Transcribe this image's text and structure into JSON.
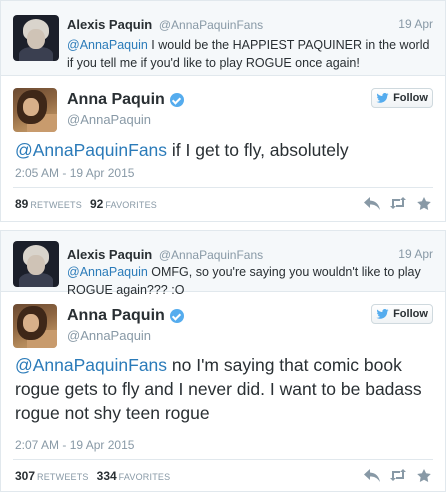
{
  "threads": [
    {
      "reply": {
        "name": "Alexis Paquin",
        "handle": "@AnnaPaquinFans",
        "time": "19 Apr",
        "mention": "@AnnaPaquin",
        "text": " I would be the HAPPIEST PAQUINER in the world if you tell me if you'd like to play ROGUE once again!"
      },
      "tweet": {
        "name": "Anna Paquin",
        "handle": "@AnnaPaquin",
        "follow_label": "Follow",
        "mention": "@AnnaPaquinFans",
        "text": " if I get to fly, absolutely",
        "date": "2:05 AM - 19 Apr 2015",
        "retweets": "89",
        "retweets_label": "RETWEETS",
        "favorites": "92",
        "favorites_label": "FAVORITES"
      }
    },
    {
      "reply": {
        "name": "Alexis Paquin",
        "handle": "@AnnaPaquinFans",
        "time": "19 Apr",
        "mention": "@AnnaPaquin",
        "text": " OMFG, so you're saying you wouldn't like to play ROGUE again??? :O"
      },
      "tweet": {
        "name": "Anna Paquin",
        "handle": "@AnnaPaquin",
        "follow_label": "Follow",
        "mention": "@AnnaPaquinFans",
        "text": " no I'm saying that comic book rogue gets to fly and I never did. I want to be badass rogue not shy teen rogue",
        "date": "2:07 AM - 19 Apr 2015",
        "retweets": "307",
        "retweets_label": "RETWEETS",
        "favorites": "334",
        "favorites_label": "FAVORITES"
      }
    }
  ],
  "icons": {
    "verified": "verified-badge-icon",
    "follow": "twitter-bird-icon",
    "reply": "reply-icon",
    "retweet": "retweet-icon",
    "favorite": "star-icon"
  },
  "colors": {
    "link": "#2b7bb9",
    "muted": "#8899a6",
    "text": "#292f33",
    "verified": "#55acee",
    "reply_bg": "#f5f8fa",
    "border": "#e1e8ed"
  }
}
